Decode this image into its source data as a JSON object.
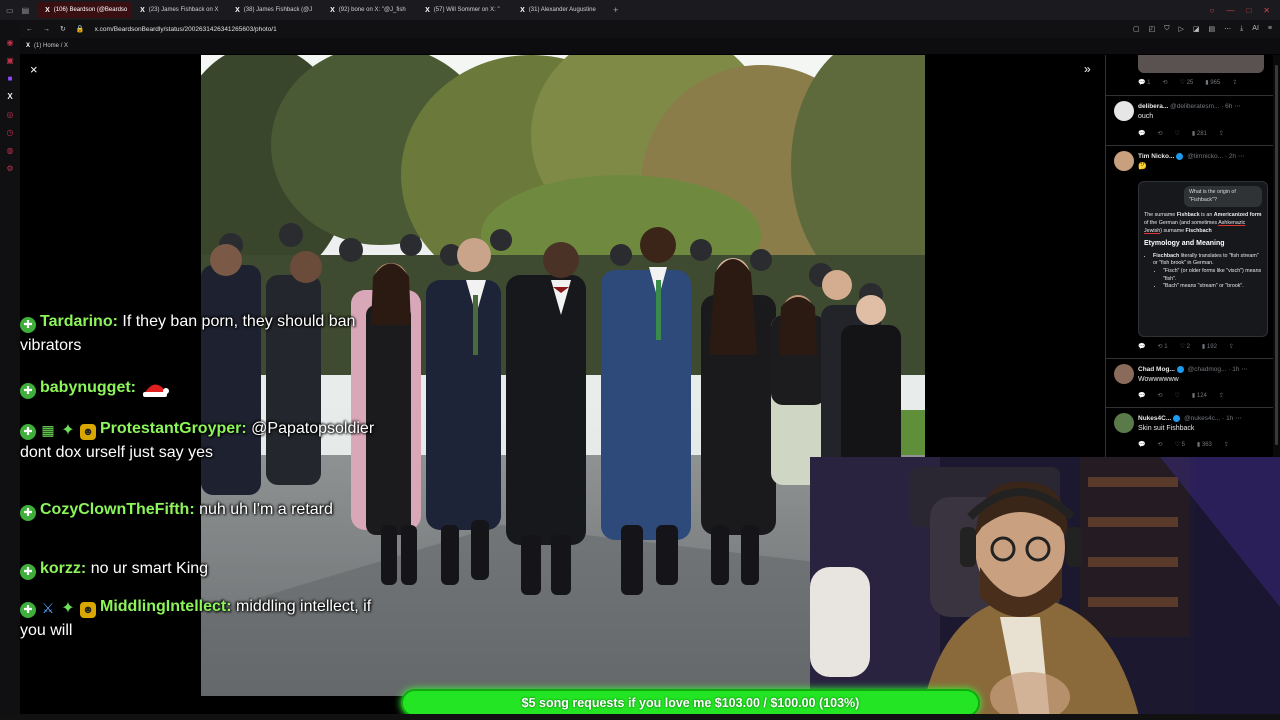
{
  "browser": {
    "tabs": [
      {
        "label": "(106) Beardson (@Beardso",
        "active": true
      },
      {
        "label": "(23) James Fishback on X",
        "active": false
      },
      {
        "label": "(38) James Fishback (@J",
        "active": false
      },
      {
        "label": "(92) bone on X: \"@J_fish",
        "active": false
      },
      {
        "label": "(57) Will Sommer on X: \"",
        "active": false
      },
      {
        "label": "(31) Alexander Augustine",
        "active": false
      }
    ],
    "url": "x.com/BeardsonBeardly/status/2002631426341265603/photo/1",
    "bookmark": "(1) Home / X",
    "ai_label": "AI"
  },
  "viewer": {
    "close_glyph": "×",
    "expand_glyph": "»"
  },
  "thread": {
    "top_actions": {
      "replies": "1",
      "likes": "25",
      "views": "965"
    },
    "tweets": [
      {
        "name": "delibera...",
        "handle": "@deliberatesm... · 6h",
        "text": "ouch",
        "likes": "",
        "views": "281",
        "verified": false
      },
      {
        "name": "Tim Nicko...",
        "handle": "@timnicko... · 2h",
        "text": "🤔",
        "replies": "1",
        "likes": "2",
        "views": "192",
        "verified": true
      },
      {
        "name": "Chad Mog...",
        "handle": "@chadmog... · 1h",
        "text": "Wowwwwww",
        "views": "124",
        "verified": true
      },
      {
        "name": "Nukes4C...",
        "handle": "@nukes4c... · 1h",
        "text": "Skin suit Fishback",
        "likes": "5",
        "views": "363",
        "verified": true
      }
    ],
    "ai_card": {
      "question": "What is the origin of \"Fishback\"?",
      "intro_pre": "The surname ",
      "intro_bold": "Fishback",
      "intro_mid": " is an ",
      "intro_bold2": "Americanized form",
      "intro_rest": " of the German (and sometimes ",
      "intro_underline": "Ashkenazic Jewish",
      "intro_end": ") surname ",
      "intro_bold3": "Fischbach",
      "heading": "Etymology and Meaning",
      "bullet1_bold": "Fischbach",
      "bullet1_rest": " literally translates to \"fish stream\" or \"fish brook\" in German.",
      "sub1": "\"Fisch\" (or older forms like \"visch\") means \"fish\".",
      "sub2": "\"Bach\" means \"stream\" or \"brook\"."
    }
  },
  "chat": [
    {
      "user": "Tardarino:",
      "text": "If they ban porn, they should ban vibrators"
    },
    {
      "user": "babynugget:",
      "text": ""
    },
    {
      "user": "ProtestantGroyper:",
      "text": "@Papatopsoldier dont dox urself just say yes"
    },
    {
      "user": "CozyClownTheFifth:",
      "text": "nuh uh I'm a retard"
    },
    {
      "user": "korzz:",
      "text": "no ur smart King"
    },
    {
      "user": "MiddlingIntellect:",
      "text": "middling intellect, if you will"
    }
  ],
  "goal": {
    "label": "$5 song requests if you love me $103.00 / $100.00 (103%)",
    "progress": 1.0
  },
  "colors": {
    "chat_user": "#8cf55a",
    "goal_green": "#1fdb1f",
    "verified_blue": "#1d9bf0"
  }
}
